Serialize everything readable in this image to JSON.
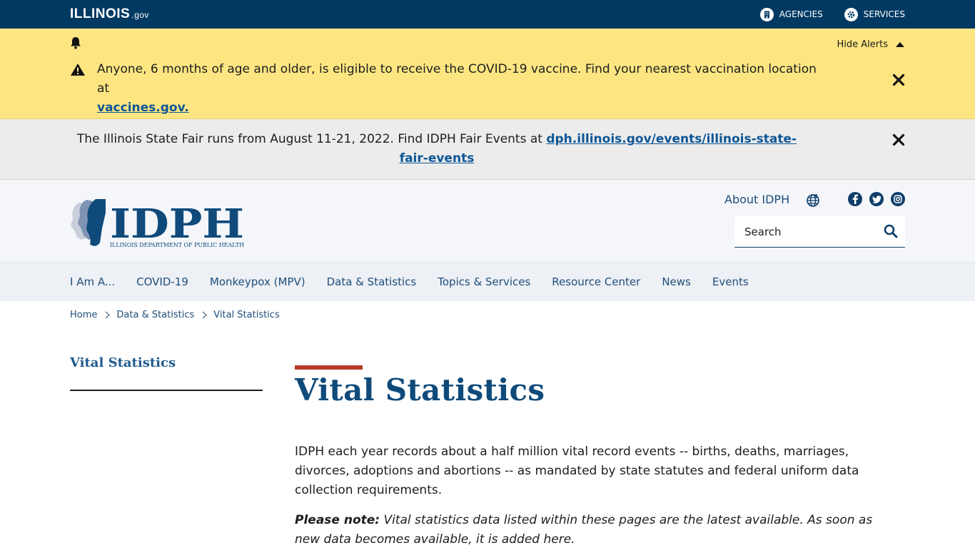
{
  "topbar": {
    "brand": "ILLINOIS",
    "brand_suffix": ".gov",
    "agencies_label": "AGENCIES",
    "services_label": "SERVICES"
  },
  "alerts": {
    "hide_label": "Hide Alerts",
    "covid_text": "Anyone, 6 months of age and older, is eligible to receive the COVID-19 vaccine. Find your nearest vaccination location at",
    "covid_link": "vaccines.gov.",
    "fair_text": "The Illinois State Fair runs from August 11-21, 2022. Find IDPH Fair Events at",
    "fair_link": "dph.illinois.gov/events/illinois-state-fair-events"
  },
  "header": {
    "logo_text": "IDPH",
    "logo_sub": "ILLINOIS DEPARTMENT OF PUBLIC HEALTH",
    "about_label": "About IDPH",
    "search_placeholder": "Search"
  },
  "nav": {
    "items": [
      "I Am A...",
      "COVID-19",
      "Monkeypox (MPV)",
      "Data & Statistics",
      "Topics & Services",
      "Resource Center",
      "News",
      "Events"
    ]
  },
  "breadcrumb": {
    "items": [
      "Home",
      "Data & Statistics",
      "Vital Statistics"
    ]
  },
  "sidebar": {
    "title": "Vital Statistics"
  },
  "main": {
    "title": "Vital Statistics",
    "paragraph1": "IDPH each year records about a half million vital record events -- births, deaths, marriages, divorces, adoptions and abortions -- as mandated by state statutes and federal uniform data collection requirements.",
    "note_label": "Please note:",
    "note_text": " Vital statistics data listed within these pages are the latest available. As soon as new data becomes available, it is added here."
  },
  "colors": {
    "topbar": "#003a63",
    "alert_yellow": "#fde682",
    "alert_gray": "#ececec",
    "link_blue": "#0d5696",
    "title_blue": "#0f4a7b",
    "accent_red": "#b73a2a"
  }
}
